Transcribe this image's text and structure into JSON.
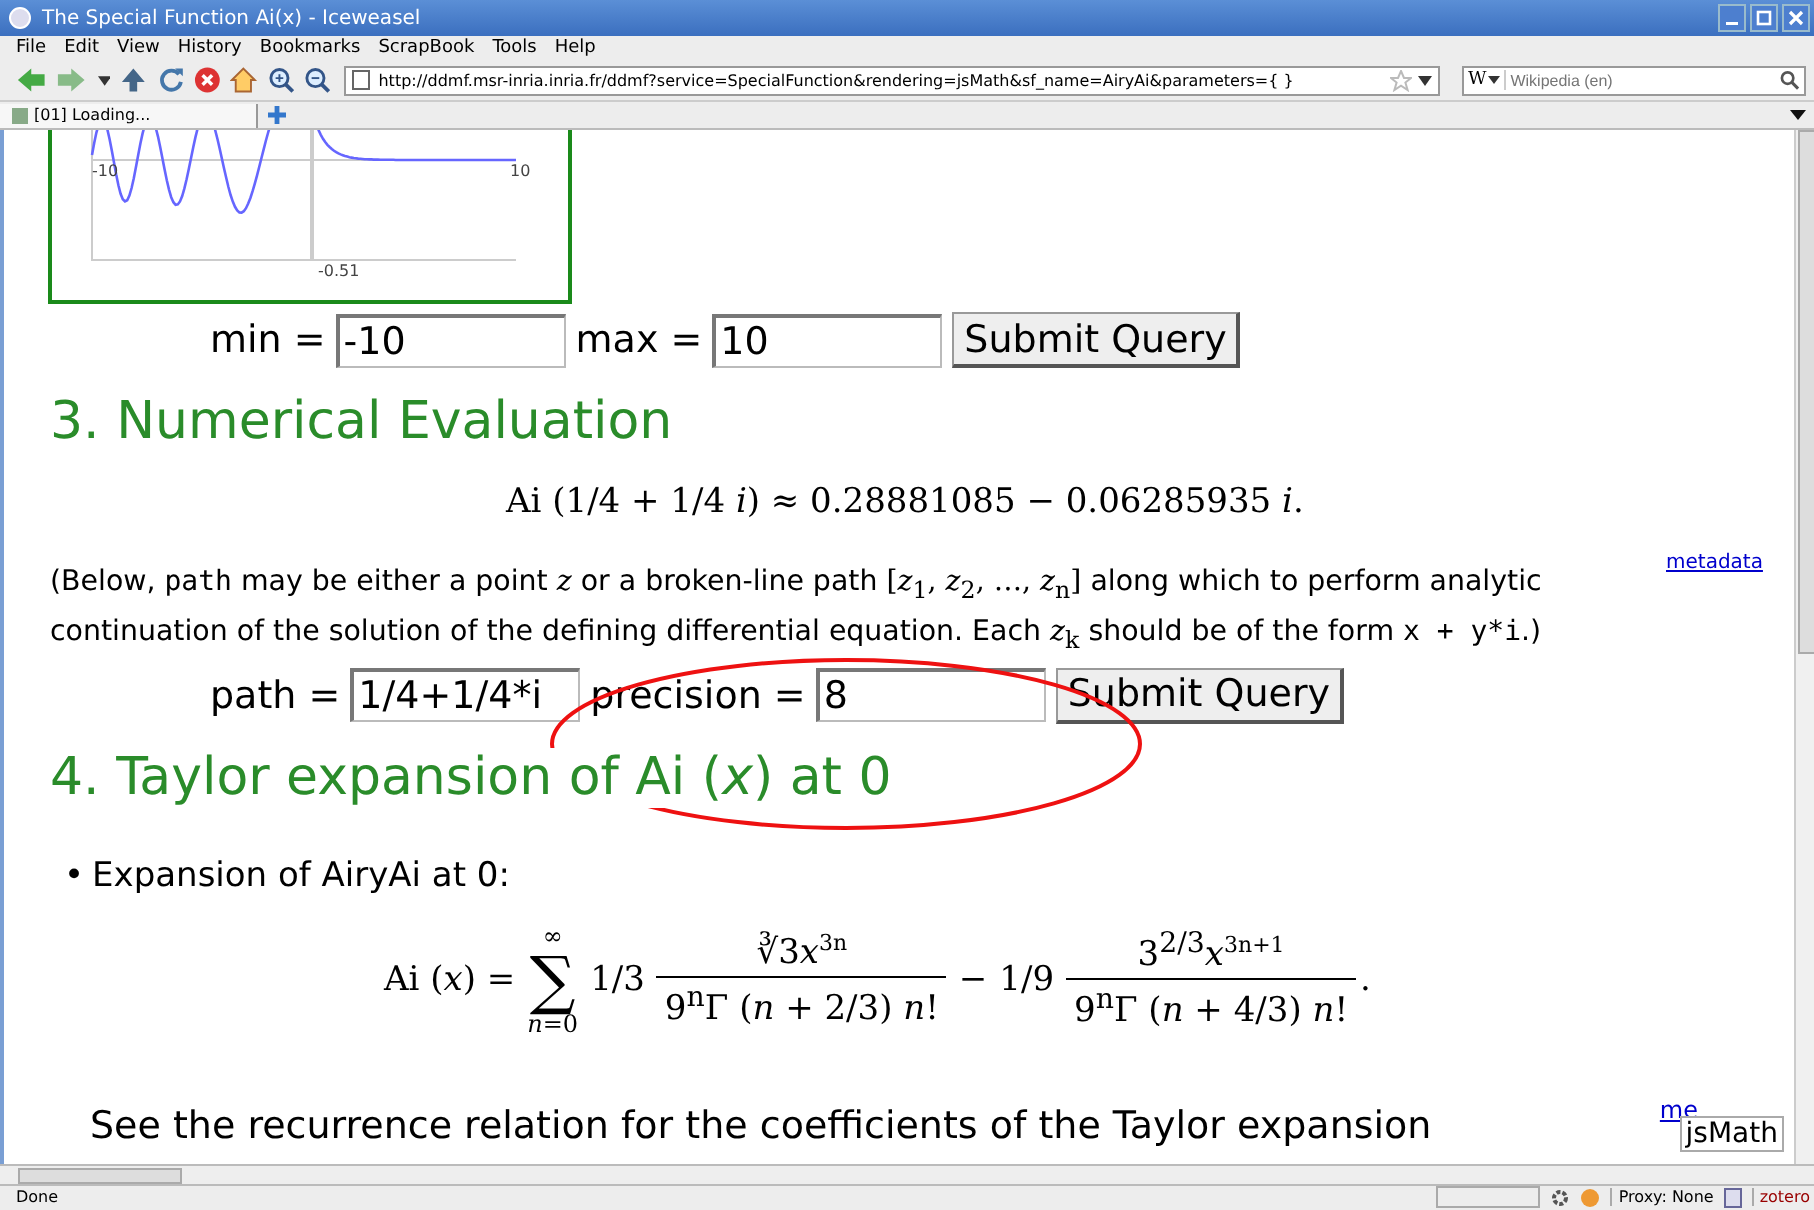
{
  "window": {
    "title": "The Special Function Ai(x) - Iceweasel"
  },
  "menu": [
    "File",
    "Edit",
    "View",
    "History",
    "Bookmarks",
    "ScrapBook",
    "Tools",
    "Help"
  ],
  "address_bar": {
    "url": "http://ddmf.msr-inria.inria.fr/ddmf?service=SpecialFunction&rendering=jsMath&sf_name=AiryAi&parameters={ }"
  },
  "search": {
    "engine": "W",
    "placeholder": "Wikipedia (en)"
  },
  "tabs": [
    {
      "label": "[01] Loading...",
      "selected": true
    }
  ],
  "plot": {
    "x_min_label": "-10",
    "x_max_label": "10",
    "y_min_label": "-0.51"
  },
  "range_form": {
    "fields": [
      {
        "label": "min =",
        "value": "-10"
      },
      {
        "label": "max =",
        "value": "10"
      }
    ],
    "button": "Submit Query"
  },
  "section_3": {
    "heading": "3. Numerical Evaluation",
    "result": "Ai (1/4 + 1/4 *i*) ≈ 0.28881085 − 0.06285935 *i*.",
    "note": [
      {
        "kind": "text",
        "text": "(Below, "
      },
      {
        "kind": "code",
        "text": "path"
      },
      {
        "kind": "text",
        "text": " may be either a point "
      },
      {
        "kind": "math",
        "text": "*z*"
      },
      {
        "kind": "text",
        "text": " or a broken-line path "
      },
      {
        "kind": "math",
        "text": "[*z*$_{1}$, *z*$_{2}$, …, *z*$_{n}$]"
      },
      {
        "kind": "text",
        "text": " along which to perform analytic continuation of the solution of the defining differential equation. Each "
      },
      {
        "kind": "math",
        "text": "*z*$_{k}$"
      },
      {
        "kind": "text",
        "text": " should be of the form "
      },
      {
        "kind": "code",
        "text": "x + y*i"
      },
      {
        "kind": "text",
        "text": ".)"
      }
    ],
    "metadata_link": "metadata"
  },
  "path_form": {
    "fields": [
      {
        "label": "path =",
        "value": "1/4+1/4*i"
      },
      {
        "label": "precision =",
        "value": "8"
      }
    ],
    "button": "Submit Query"
  },
  "section_4": {
    "heading": "4. Taylor expansion of Ai (*x*) at 0",
    "bullet_mark": "•",
    "bullet": "Expansion of AiryAi at 0:",
    "formula": {
      "lhs": "Ai (*x*) =",
      "sum_upper": "∞",
      "sum_symbol": "∑",
      "sum_lower": "*n*=0",
      "terms": [
        {
          "coef": "1/3",
          "numerator": {
            "prefix": "∛3",
            "variable": "x",
            "power": "3n"
          },
          "denominator": "9$^{n}$Γ (*n* + 2/3) *n*!"
        },
        {
          "sign": "−",
          "coef": "1/9",
          "numerator": {
            "prefix": "3$^{2/3}$",
            "variable": "x",
            "power": "3n+1"
          },
          "denominator": "9$^{n}$Γ (*n* + 4/3) *n*!"
        }
      ],
      "end": "."
    },
    "recurrence_line": "See the recurrence relation for the coefficients of the Taylor expansion",
    "metadata_link": "me"
  },
  "jsmath_badge": "jsMath",
  "status_bar": {
    "text": "Done",
    "proxy": "Proxy: None",
    "zotero": "zotero"
  }
}
